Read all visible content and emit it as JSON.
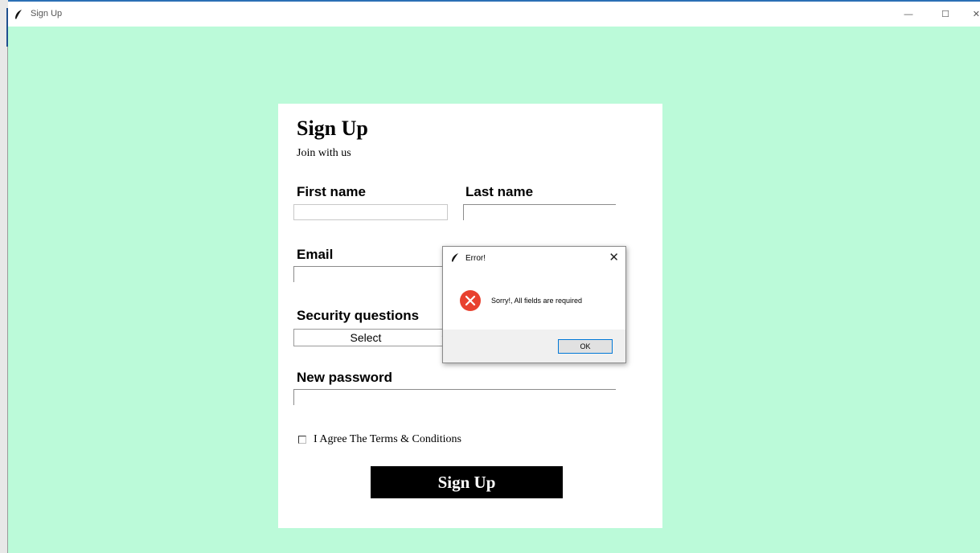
{
  "window": {
    "title": "Sign Up",
    "minimize_glyph": "—",
    "maximize_glyph": "☐",
    "close_glyph": "✕",
    "app_icon": "feather-icon"
  },
  "colors": {
    "app_background": "#bbfad9",
    "card_background": "#ffffff",
    "button_background": "#000000",
    "button_text": "#ffffff",
    "error_icon": "#e8412f",
    "dialog_footer": "#f0f0f0",
    "ok_button_border": "#0078d7"
  },
  "form": {
    "heading": "Sign Up",
    "subheading": "Join with us",
    "first_name_label": "First name",
    "first_name_value": "",
    "last_name_label": "Last name",
    "last_name_value": "",
    "email_label": "Email",
    "email_value": "",
    "security_label": "Security questions",
    "security_selected": "Select",
    "security_chevron": "⌄",
    "password_label": "New password",
    "password_value": "",
    "agree_label": "I Agree The Terms & Conditions",
    "agree_checked": false,
    "submit_label": "Sign Up"
  },
  "dialog": {
    "title": "Error!",
    "close_glyph": "✕",
    "icon": "error-icon",
    "message": "Sorry!, All fields are required",
    "ok_label": "OK"
  }
}
